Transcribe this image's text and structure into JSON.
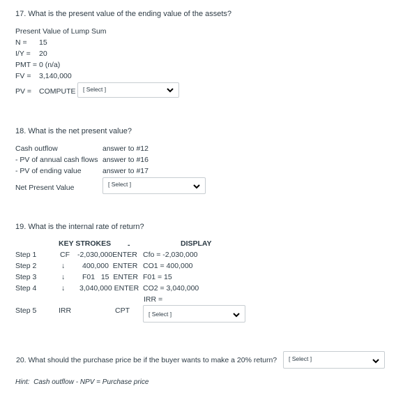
{
  "q17": {
    "question": "17. What is the present value of the ending value of the assets?",
    "subtitle": "Present Value of Lump Sum",
    "rows": [
      {
        "label": "N =",
        "value": "15"
      },
      {
        "label": "I/Y =",
        "value": "20"
      },
      {
        "label": "PMT = 0 (n/a)",
        "value": ""
      },
      {
        "label": "FV =",
        "value": "3,140,000"
      }
    ],
    "pv_label": "PV =",
    "pv_compute": "COMPUTE",
    "select_placeholder": "[ Select ]"
  },
  "q18": {
    "question": "18. What is the net present value?",
    "rows": [
      {
        "label": "Cash outflow",
        "value": "answer to #12"
      },
      {
        "label": "- PV of annual cash flows",
        "value": "answer to #16"
      },
      {
        "label": "- PV of ending value",
        "value": "answer to #17"
      }
    ],
    "npv_label": "Net Present Value",
    "select_placeholder": "[ Select ]"
  },
  "q19": {
    "question": "19. What is the internal rate of return?",
    "header_keystrokes": "KEY STROKES",
    "header_dash": "-",
    "header_display": "DISPLAY",
    "steps": [
      {
        "step": "Step 1",
        "key": "CF",
        "entry": "-2,030,000ENTER",
        "display": "Cfo = -2,030,000"
      },
      {
        "step": "Step 2",
        "key": "↓",
        "entry": "400,000  ENTER",
        "display": "CO1 = 400,000"
      },
      {
        "step": "Step 3",
        "key": "↓",
        "entry": "F01   15  ENTER",
        "display": "F01 = 15"
      },
      {
        "step": "Step 4",
        "key": "↓",
        "entry": "3,040,000 ENTER",
        "display": "CO2 = 3,040,000"
      }
    ],
    "irr_label": "IRR =",
    "step5": {
      "step": "Step 5",
      "key": "IRR",
      "entry": "CPT"
    },
    "select_placeholder": "[ Select ]"
  },
  "q20": {
    "question": "20. What should the purchase price be if the buyer wants to make a 20% return?",
    "select_placeholder": "[ Select ]",
    "hint": "Hint:  Cash outflow - NPV = Purchase price"
  }
}
